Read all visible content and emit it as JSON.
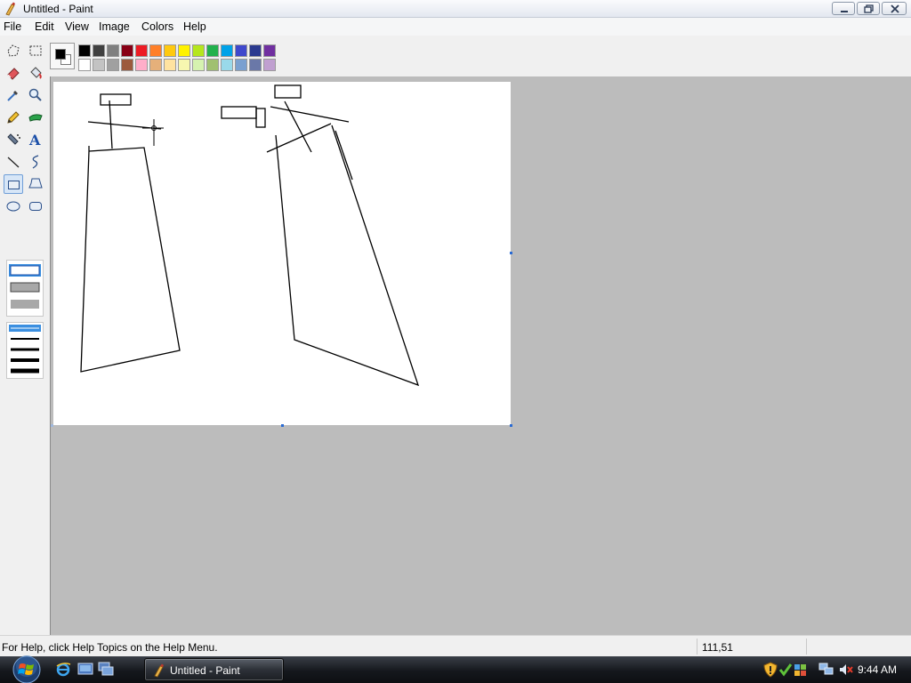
{
  "window": {
    "title": "Untitled - Paint"
  },
  "menu": {
    "items": [
      "File",
      "Edit",
      "View",
      "Image",
      "Colors",
      "Help"
    ]
  },
  "tools": [
    {
      "name": "free-form-select",
      "icon": "free-select-icon"
    },
    {
      "name": "select",
      "icon": "select-icon"
    },
    {
      "name": "eraser",
      "icon": "eraser-icon"
    },
    {
      "name": "fill-with-color",
      "icon": "fill-bucket-icon"
    },
    {
      "name": "pick-color",
      "icon": "eyedropper-icon"
    },
    {
      "name": "magnifier",
      "icon": "magnifier-icon"
    },
    {
      "name": "pencil",
      "icon": "pencil-icon"
    },
    {
      "name": "brush",
      "icon": "brush-icon"
    },
    {
      "name": "airbrush",
      "icon": "airbrush-icon"
    },
    {
      "name": "text",
      "icon": "text-icon",
      "glyph": "A"
    },
    {
      "name": "line",
      "icon": "line-icon"
    },
    {
      "name": "curve",
      "icon": "curve-icon"
    },
    {
      "name": "rectangle",
      "icon": "rectangle-icon",
      "selected": true
    },
    {
      "name": "polygon",
      "icon": "polygon-icon"
    },
    {
      "name": "ellipse",
      "icon": "ellipse-icon"
    },
    {
      "name": "rounded-rectangle",
      "icon": "rounded-rectangle-icon"
    }
  ],
  "colors": {
    "foreground": "#000000",
    "background": "#ffffff",
    "palette_top": [
      "#000000",
      "#404040",
      "#7f7f7f",
      "#880015",
      "#ed1c24",
      "#ff7f27",
      "#ffc90e",
      "#fff200",
      "#b5e61d",
      "#22b14c",
      "#00a2e8",
      "#3f48cc",
      "#2b3a8f",
      "#7030a0"
    ],
    "palette_bottom": [
      "#ffffff",
      "#c3c3c3",
      "#a0a0a0",
      "#9c5a3c",
      "#ffaec9",
      "#e5b07a",
      "#ffe3a0",
      "#f7f7b0",
      "#d6f2b0",
      "#a0c070",
      "#99d9ea",
      "#7aa0d0",
      "#6a78a8",
      "#c0a0d0"
    ]
  },
  "status": {
    "help_text": "For Help, click Help Topics on the Help Menu.",
    "coordinates": "111,51"
  },
  "taskbar": {
    "button_label": "Untitled - Paint",
    "clock": "9:44 AM"
  }
}
